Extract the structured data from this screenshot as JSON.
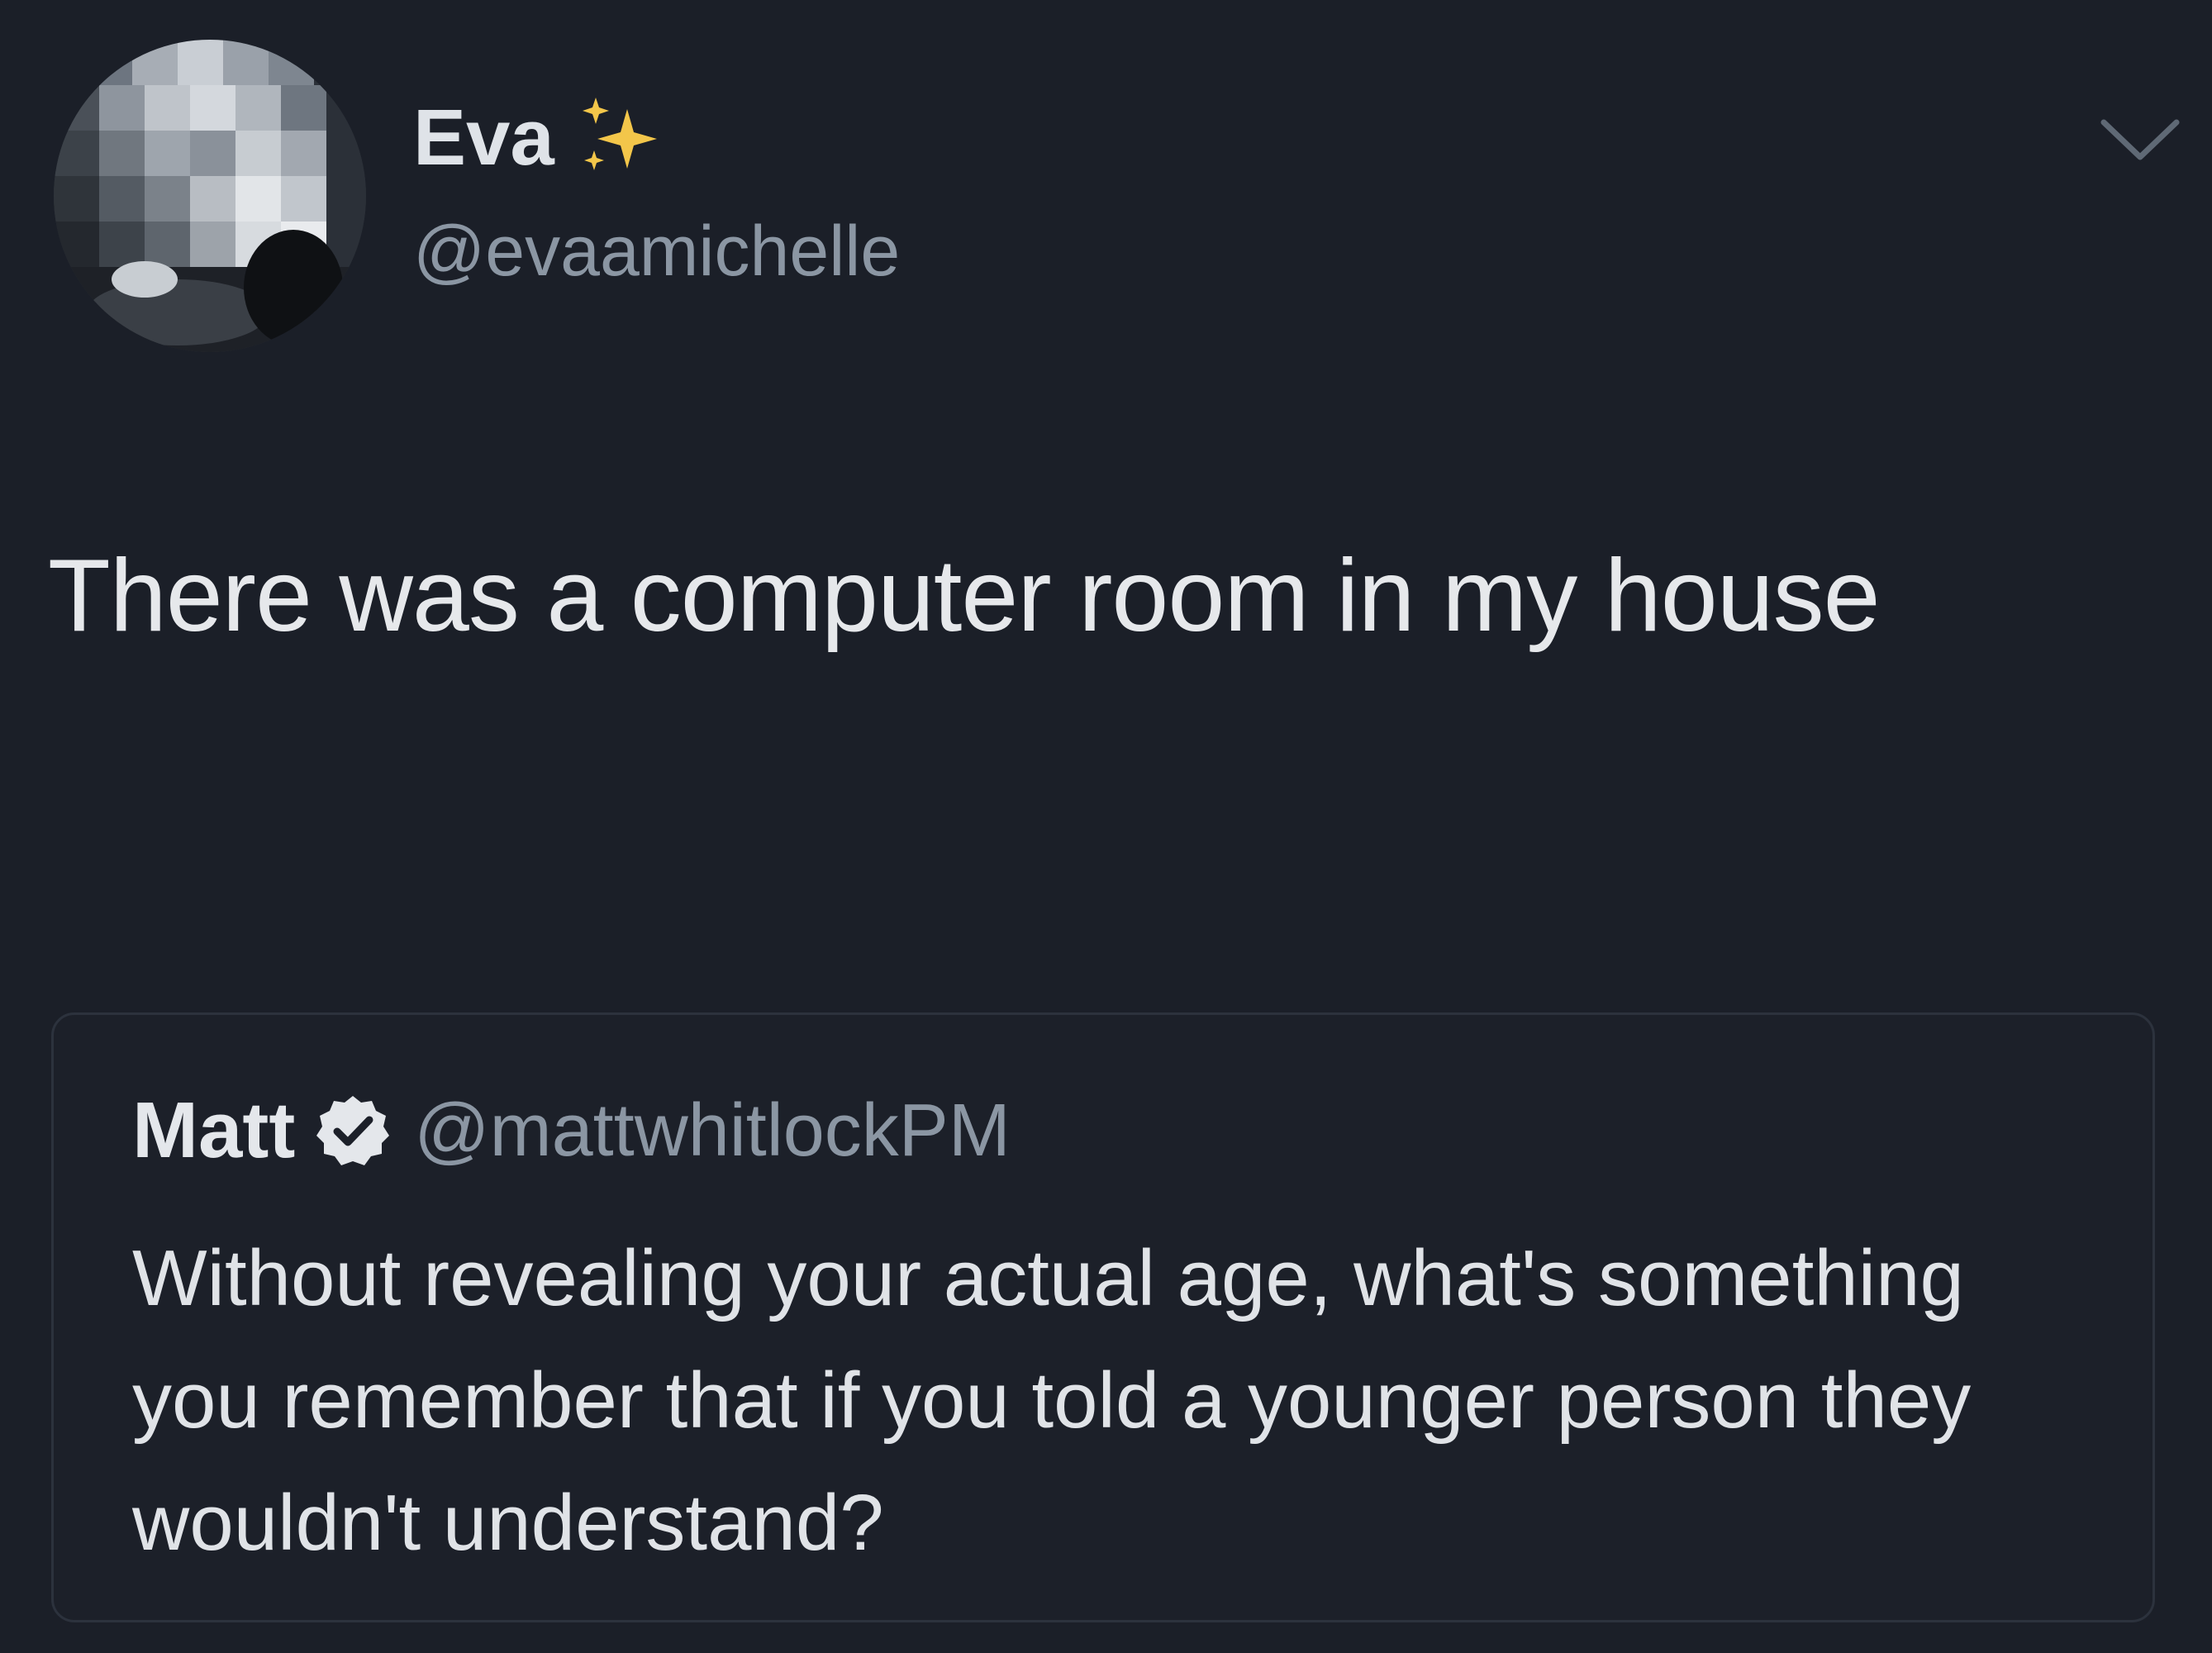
{
  "tweet": {
    "author": {
      "display_name": "Eva",
      "handle": "@evaamichelle",
      "name_emoji": "sparkles-icon"
    },
    "text": "There was a computer room in my house",
    "menu_icon": "chevron-down-icon"
  },
  "quoted_tweet": {
    "author": {
      "display_name": "Matt",
      "handle": "@mattwhitlockPM",
      "verified": true
    },
    "text": "Without revealing your actual age, what's something you remember that if you told a younger person they wouldn't understand?"
  },
  "colors": {
    "background": "#1b1f28",
    "primary_text": "#e6e8eb",
    "secondary_text": "#8b96a3",
    "sparkle": "#f3c64a"
  }
}
